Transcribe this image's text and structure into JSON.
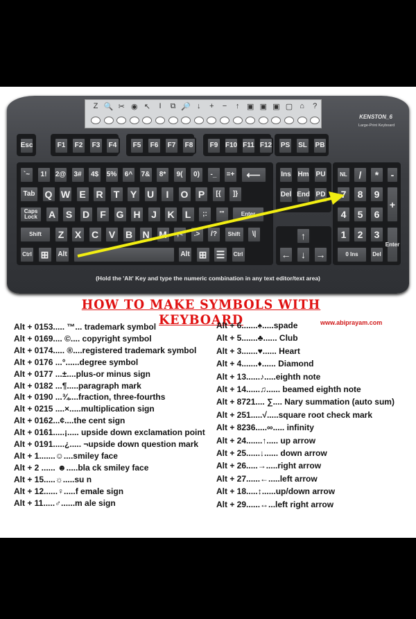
{
  "keyboard": {
    "brand": "KENSTON_6",
    "brand_subtitle": "Large-Print Keyboard",
    "media_icons": [
      "Z",
      "🔍",
      "✂",
      "◉",
      "↖",
      "I",
      "⧉",
      "🔎",
      "↓",
      "+",
      "−",
      "↑",
      "▣",
      "▣",
      "▣",
      "▢",
      "⌂",
      "?"
    ],
    "function_keys": [
      "Esc",
      "F1",
      "F2",
      "F3",
      "F4",
      "F5",
      "F6",
      "F7",
      "F8",
      "F9",
      "F10",
      "F11",
      "F12",
      "PS",
      "SL",
      "PB"
    ],
    "rows": [
      [
        "`~",
        "1!",
        "2@",
        "3#",
        "4$",
        "5%",
        "6^",
        "7&",
        "8*",
        "9(",
        "0)",
        "-_",
        "=+",
        "⟵"
      ],
      [
        "Tab",
        "Q",
        "W",
        "E",
        "R",
        "T",
        "Y",
        "U",
        "I",
        "O",
        "P",
        "[{",
        "]}"
      ],
      [
        "Caps Lock",
        "A",
        "S",
        "D",
        "F",
        "G",
        "H",
        "J",
        "K",
        "L",
        ";:",
        "'\"",
        "Enter"
      ],
      [
        "Shift",
        "Z",
        "X",
        "C",
        "V",
        "B",
        "N",
        "M",
        ",<",
        ".>",
        "/?",
        "Shift",
        "\\|"
      ],
      [
        "Ctrl",
        "⊞",
        "Alt",
        "",
        "Alt",
        "⊞",
        "☰",
        "Ctrl"
      ]
    ],
    "nav": [
      "Ins",
      "Hm",
      "PU",
      "Del",
      "End",
      "PD"
    ],
    "arrows": [
      "↑",
      "←",
      "↓",
      "→"
    ],
    "numpad": [
      "NL",
      "/",
      "*",
      "-",
      "7",
      "8",
      "9",
      "+",
      "4",
      "5",
      "6",
      "1",
      "2",
      "3",
      "Enter",
      "0 Ins",
      "Del"
    ],
    "caption": "(Hold the 'Alt' Key and type the numeric combination in any text editor/text area)",
    "highlight_color": "#f2ee12"
  },
  "title": "HOW TO MAKE SYMBOLS WITH KEYBOARD",
  "website": "www.abiprayam.com",
  "left_list": [
    "Alt + 0153..... ™... trademark symbol",
    "Alt + 0169.... ©.... copyright symbol",
    "Alt + 0174..... ®....registered  trademark symbol",
    "Alt + 0176 ...°......degree symbol",
    "Alt + 0177 ...±....plus-or minus sign",
    "Alt + 0182 ...¶.....paragraph mark",
    "Alt + 0190 ...¾....fraction, three-fourths",
    "Alt + 0215 ....×.....multiplication sign",
    "Alt + 0162...¢....the cent sign",
    "Alt + 0161.....¡..... upside down exclamation point",
    "Alt + 0191.....¿..... ¬upside down question mark",
    "Alt + 1.......☺....smiley face",
    "Alt + 2 ...... ☻.....bla ck smiley face",
    "Alt + 15.....☼.....su n",
    "Alt + 12......♀.....f emale sign",
    "Alt + 11.....♂......m ale sign"
  ],
  "right_list": [
    "Alt + 6.......♠.....spade",
    "Alt + 5.......♣...... Club",
    "Alt + 3.......♥...... Heart",
    "Alt + 4.......♦...... Diamond",
    "Alt + 13......♪.....eighth note",
    "Alt + 14......♫...... beamed eighth note",
    "Alt + 8721.... ∑.... Nary summation (auto sum)",
    "Alt + 251.....√.....square root check mark",
    "Alt + 8236.....∞..... infinity",
    "Alt + 24.......↑..... up arrow",
    "Alt + 25......↓...... down arrow",
    "Alt + 26.....→.....right arrow",
    "Alt + 27......←.....left arrow",
    "Alt + 18.....↕......up/down arrow",
    "Alt + 29......↔...left right arrow"
  ]
}
